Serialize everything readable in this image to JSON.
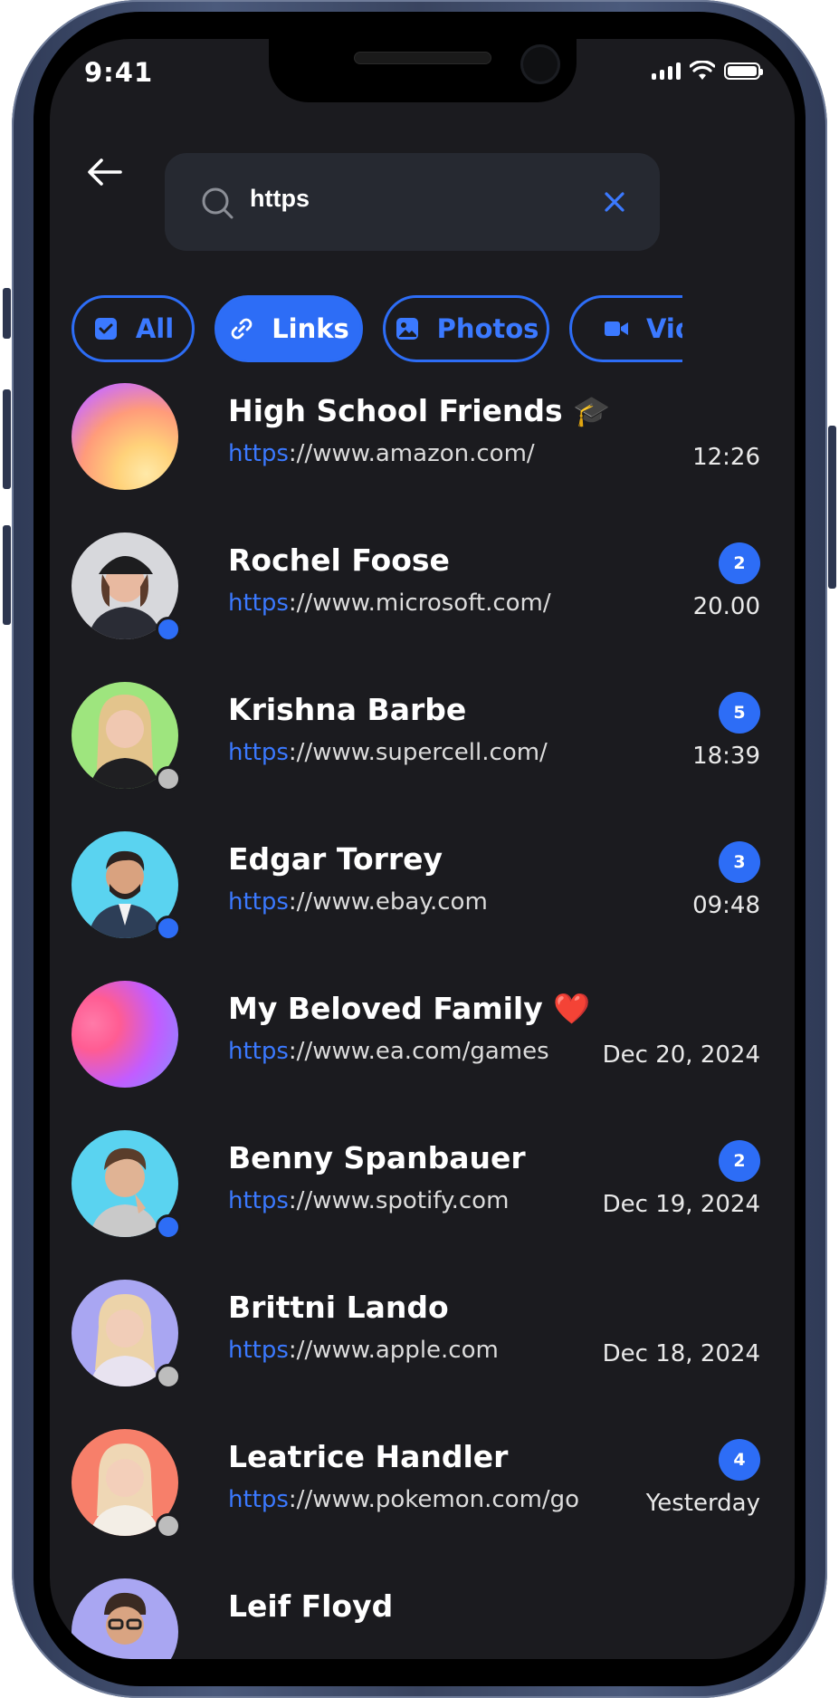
{
  "status_bar": {
    "time": "9:41"
  },
  "search": {
    "query": "https",
    "clear_symbol": "×"
  },
  "filters": [
    {
      "label": "All",
      "icon": "checkbox-icon",
      "active": false
    },
    {
      "label": "Links",
      "icon": "link-icon",
      "active": true
    },
    {
      "label": "Photos",
      "icon": "image-icon",
      "active": false
    },
    {
      "label": "Vid",
      "icon": "video-icon",
      "active": false
    }
  ],
  "chats": [
    {
      "name": "High School Friends 🎓",
      "scheme": "https",
      "rest": "://www.amazon.com/",
      "time": "12:26",
      "badge": "",
      "status": "none",
      "avatar": "gradient-orange"
    },
    {
      "name": "Rochel Foose",
      "scheme": "https",
      "rest": "://www.microsoft.com/",
      "time": "20.00",
      "badge": "2",
      "status": "online",
      "avatar": "person-cap"
    },
    {
      "name": "Krishna Barbe",
      "scheme": "https",
      "rest": "://www.supercell.com/",
      "time": "18:39",
      "badge": "5",
      "status": "offline",
      "avatar": "person-green"
    },
    {
      "name": "Edgar Torrey",
      "scheme": "https",
      "rest": "://www.ebay.com",
      "time": "09:48",
      "badge": "3",
      "status": "online",
      "avatar": "person-blue"
    },
    {
      "name": "My Beloved Family ❤️",
      "scheme": "https",
      "rest": "://www.ea.com/games",
      "time": "Dec 20, 2024",
      "badge": "",
      "status": "none",
      "avatar": "gradient-purple"
    },
    {
      "name": "Benny Spanbauer",
      "scheme": "https",
      "rest": "://www.spotify.com",
      "time": "Dec 19, 2024",
      "badge": "2",
      "status": "online",
      "avatar": "person-cyan"
    },
    {
      "name": "Brittni Lando",
      "scheme": "https",
      "rest": "://www.apple.com",
      "time": "Dec 18, 2024",
      "badge": "",
      "status": "offline",
      "avatar": "person-lavender"
    },
    {
      "name": "Leatrice Handler",
      "scheme": "https",
      "rest": "://www.pokemon.com/go",
      "time": "Yesterday",
      "badge": "4",
      "status": "offline",
      "avatar": "person-salmon"
    },
    {
      "name": "Leif Floyd",
      "scheme": "",
      "rest": "",
      "time": "",
      "badge": "",
      "status": "none",
      "avatar": "person-purple"
    }
  ],
  "colors": {
    "accent": "#2d6df6",
    "background": "#1b1b1f",
    "online": "#2d6df6",
    "offline": "#bdbdbd"
  }
}
